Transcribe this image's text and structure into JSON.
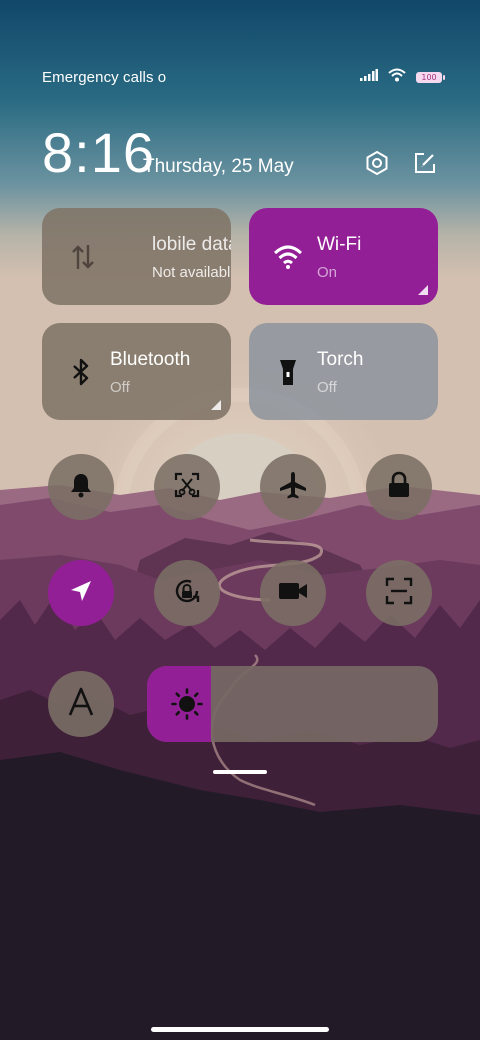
{
  "status_bar": {
    "carrier_text": "Emergency calls o",
    "battery_level": "100",
    "icons": [
      "signal-icon",
      "wifi-icon",
      "battery-icon"
    ]
  },
  "header": {
    "time": "8:16",
    "date": "Thursday, 25 May",
    "icons": [
      "settings-icon",
      "edit-icon"
    ]
  },
  "tiles": {
    "mobile_data": {
      "title": "Mobile data",
      "visible_title": "lobile data",
      "subtitle": "Not available"
    },
    "wifi": {
      "title": "Wi-Fi",
      "subtitle": "On"
    },
    "bluetooth": {
      "title": "Bluetooth",
      "subtitle": "Off"
    },
    "torch": {
      "title": "Torch",
      "subtitle": "Off"
    }
  },
  "toggles": [
    {
      "name": "sound",
      "icon": "bell-icon",
      "active": false
    },
    {
      "name": "screenshot",
      "icon": "screenshot-icon",
      "active": false
    },
    {
      "name": "airplane-mode",
      "icon": "airplane-icon",
      "active": false
    },
    {
      "name": "lock-screen",
      "icon": "lock-icon",
      "active": false
    },
    {
      "name": "location",
      "icon": "location-arrow-icon",
      "active": true
    },
    {
      "name": "rotation-lock",
      "icon": "rotation-lock-icon",
      "active": false
    },
    {
      "name": "screen-recorder",
      "icon": "video-camera-icon",
      "active": false
    },
    {
      "name": "scanner",
      "icon": "scan-icon",
      "active": false
    },
    {
      "name": "auto-brightness",
      "icon": "font-a-icon",
      "active": false,
      "label": "A"
    }
  ],
  "brightness": {
    "level": 0.22,
    "icon": "sun-icon"
  },
  "colors": {
    "accent": "#931f97",
    "tile_inactive": "#807466",
    "torch_tile": "#85909b"
  }
}
